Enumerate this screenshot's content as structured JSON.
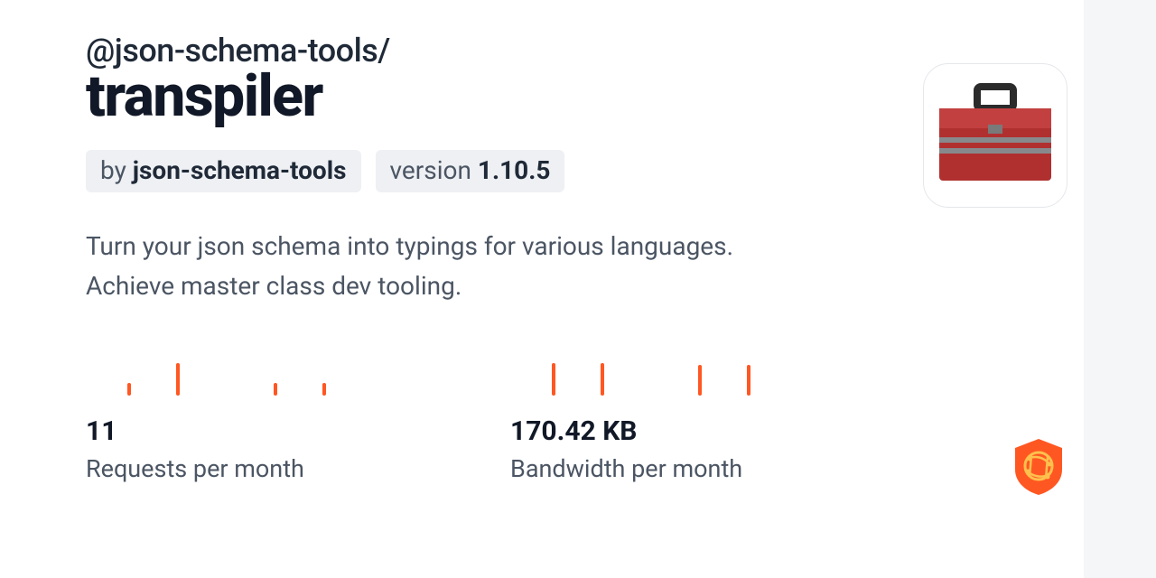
{
  "scope": "@json-schema-tools/",
  "name": "transpiler",
  "by_prefix": "by ",
  "author": "json-schema-tools",
  "version_prefix": "version ",
  "version": "1.10.5",
  "description": "Turn your json schema into typings for various languages. Achieve master class dev tooling.",
  "stats": {
    "requests": {
      "value": "11",
      "label": "Requests per month",
      "spark": [
        14,
        36,
        0,
        14,
        14
      ]
    },
    "bandwidth": {
      "value": "170.42 KB",
      "label": "Bandwidth per month",
      "spark": [
        36,
        36,
        0,
        34,
        34
      ]
    }
  }
}
